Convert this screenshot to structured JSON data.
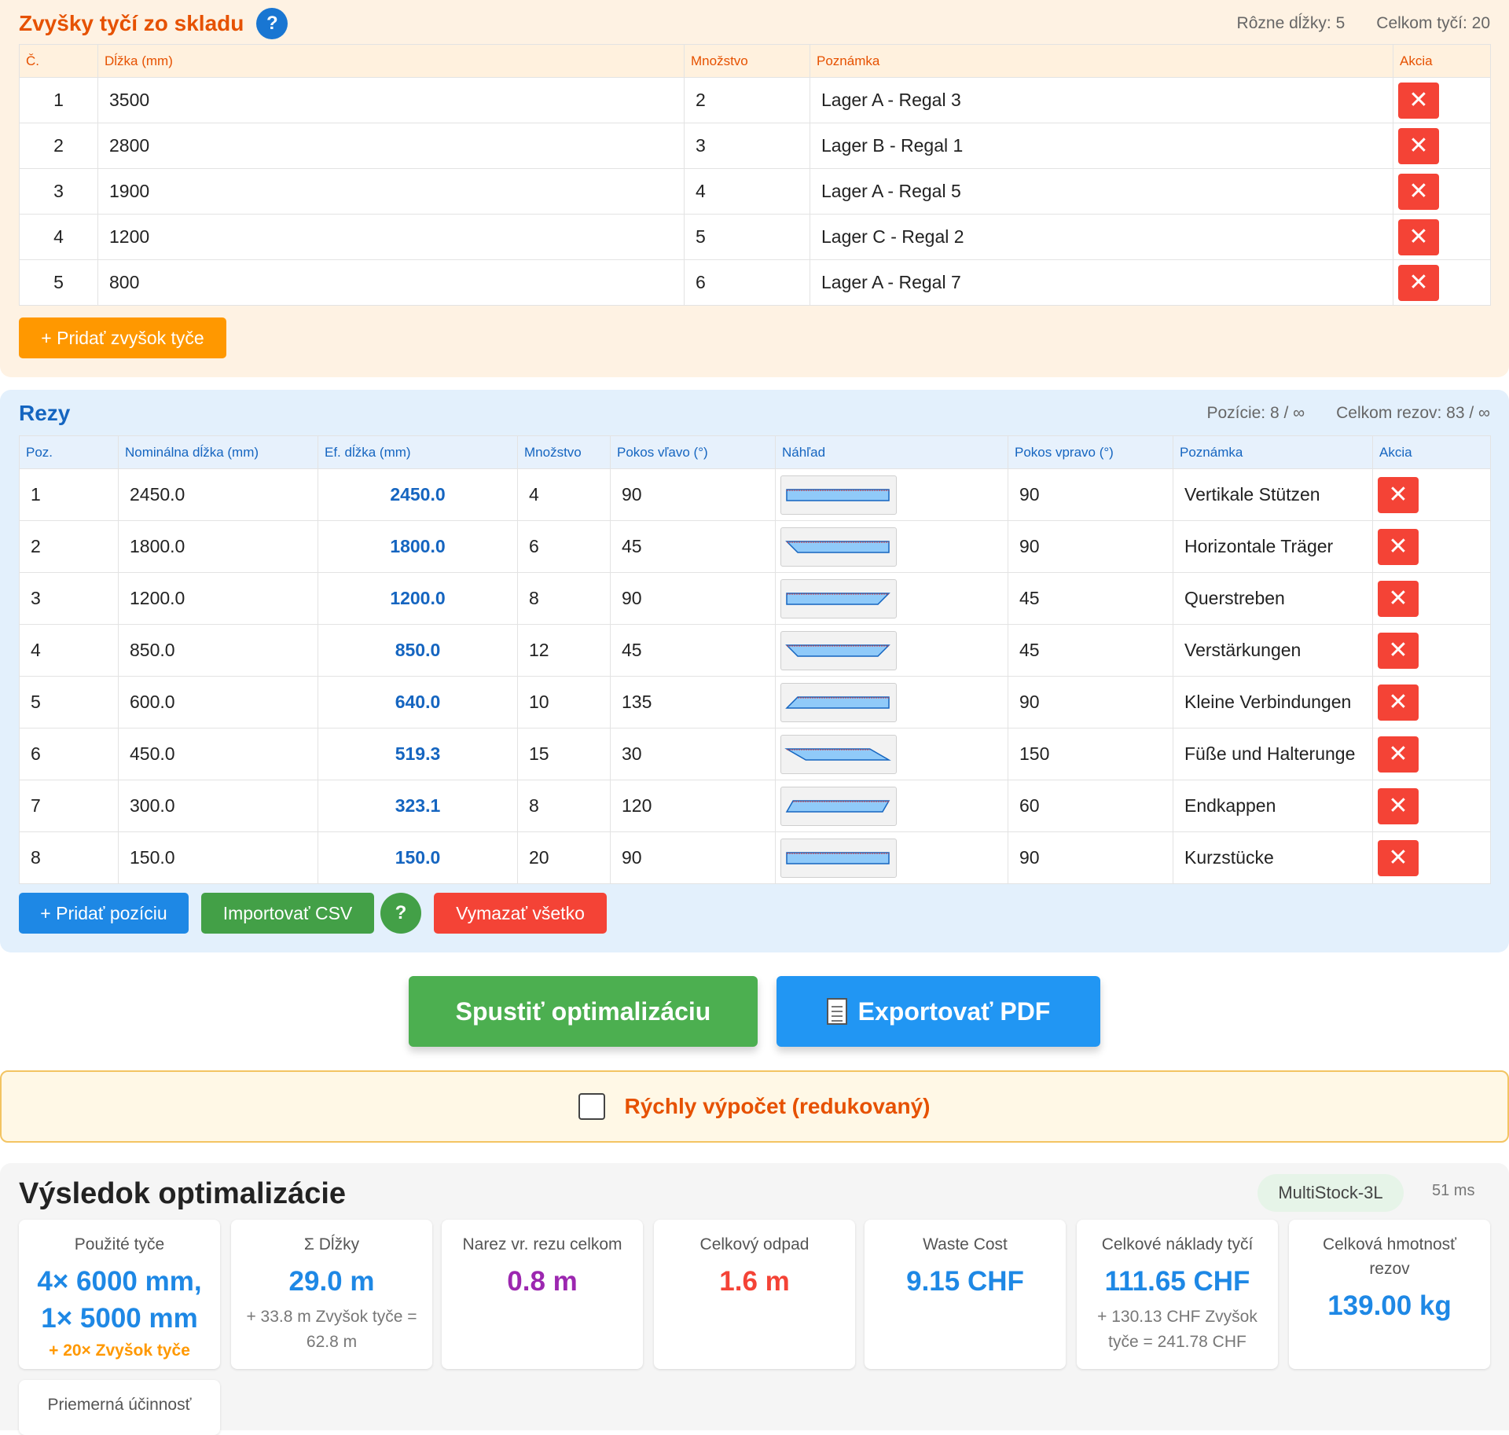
{
  "stock": {
    "title": "Zvyšky tyčí zo skladu",
    "help": "?",
    "stats": {
      "distinct": "Rôzne dĺžky: 5",
      "total": "Celkom tyčí: 20"
    },
    "headers": {
      "no": "Č.",
      "length": "Dĺžka (mm)",
      "qty": "Množstvo",
      "note": "Poznámka",
      "action": "Akcia"
    },
    "rows": [
      {
        "no": "1",
        "length": "3500",
        "qty": "2",
        "note": "Lager A - Regal 3"
      },
      {
        "no": "2",
        "length": "2800",
        "qty": "3",
        "note": "Lager B - Regal 1"
      },
      {
        "no": "3",
        "length": "1900",
        "qty": "4",
        "note": "Lager A - Regal 5"
      },
      {
        "no": "4",
        "length": "1200",
        "qty": "5",
        "note": "Lager C - Regal 2"
      },
      {
        "no": "5",
        "length": "800",
        "qty": "6",
        "note": "Lager A - Regal 7"
      }
    ],
    "delete_symbol": "✕",
    "add_button": "+ Pridať zvyšok tyče"
  },
  "cuts": {
    "title": "Rezy",
    "stats": {
      "positions": "Pozície: 8 / ∞",
      "total": "Celkom rezov: 83 / ∞"
    },
    "headers": {
      "pos": "Poz.",
      "nominal": "Nominálna dĺžka (mm)",
      "effective": "Ef. dĺžka (mm)",
      "qty": "Množstvo",
      "left": "Pokos vľavo (°)",
      "preview": "Náhľad",
      "right": "Pokos vpravo (°)",
      "note": "Poznámka",
      "action": "Akcia"
    },
    "rows": [
      {
        "pos": "1",
        "nominal": "2450.0",
        "effective": "2450.0",
        "qty": "4",
        "left": "90",
        "right": "90",
        "note": "Vertikale Stützen"
      },
      {
        "pos": "2",
        "nominal": "1800.0",
        "effective": "1800.0",
        "qty": "6",
        "left": "45",
        "right": "90",
        "note": "Horizontale Träger"
      },
      {
        "pos": "3",
        "nominal": "1200.0",
        "effective": "1200.0",
        "qty": "8",
        "left": "90",
        "right": "45",
        "note": "Querstreben"
      },
      {
        "pos": "4",
        "nominal": "850.0",
        "effective": "850.0",
        "qty": "12",
        "left": "45",
        "right": "45",
        "note": "Verstärkungen"
      },
      {
        "pos": "5",
        "nominal": "600.0",
        "effective": "640.0",
        "qty": "10",
        "left": "135",
        "right": "90",
        "note": "Kleine Verbindungen"
      },
      {
        "pos": "6",
        "nominal": "450.0",
        "effective": "519.3",
        "qty": "15",
        "left": "30",
        "right": "150",
        "note": "Füße und Halterunge"
      },
      {
        "pos": "7",
        "nominal": "300.0",
        "effective": "323.1",
        "qty": "8",
        "left": "120",
        "right": "60",
        "note": "Endkappen"
      },
      {
        "pos": "8",
        "nominal": "150.0",
        "effective": "150.0",
        "qty": "20",
        "left": "90",
        "right": "90",
        "note": "Kurzstücke"
      }
    ],
    "buttons": {
      "add": "+ Pridať pozíciu",
      "import": "Importovať CSV",
      "help": "?",
      "clear": "Vymazať všetko"
    }
  },
  "actions": {
    "optimize": "Spustiť optimalizáciu",
    "export": "Exportovať PDF"
  },
  "quick": {
    "label": "Rýchly výpočet (redukovaný)",
    "checked": false
  },
  "results": {
    "title": "Výsledok optimalizácie",
    "algorithm": "MultiStock-3L",
    "time": "51 ms",
    "cards": {
      "bars": {
        "label": "Použité tyče",
        "value_line1": "4× 6000 mm,",
        "value_line2": "1× 5000 mm",
        "sub": "+ 20× Zvyšok tyče"
      },
      "lengths": {
        "label": "Σ Dĺžky",
        "value": "29.0 m",
        "sub": "+ 33.8 m Zvyšok tyče = 62.8 m"
      },
      "kerf": {
        "label": "Narez vr. rezu celkom",
        "value": "0.8 m"
      },
      "waste": {
        "label": "Celkový odpad",
        "value": "1.6 m"
      },
      "waste_cost": {
        "label": "Waste Cost",
        "value": "9.15 CHF"
      },
      "cost": {
        "label": "Celkové náklady tyčí",
        "value": "111.65 CHF",
        "sub": "+ 130.13 CHF Zvyšok tyče = 241.78 CHF"
      },
      "weight": {
        "label": "Celková hmotnosť rezov",
        "value": "139.00 kg"
      },
      "efficiency": {
        "label": "Priemerná účinnosť"
      }
    }
  },
  "colors": {
    "stock_accent": "#e65100",
    "cuts_accent": "#1565c0",
    "delete": "#f44336",
    "success": "#4caf50",
    "primary": "#2196f3"
  },
  "icons": {
    "help": "question-icon",
    "delete": "close-icon",
    "export": "document-icon"
  }
}
